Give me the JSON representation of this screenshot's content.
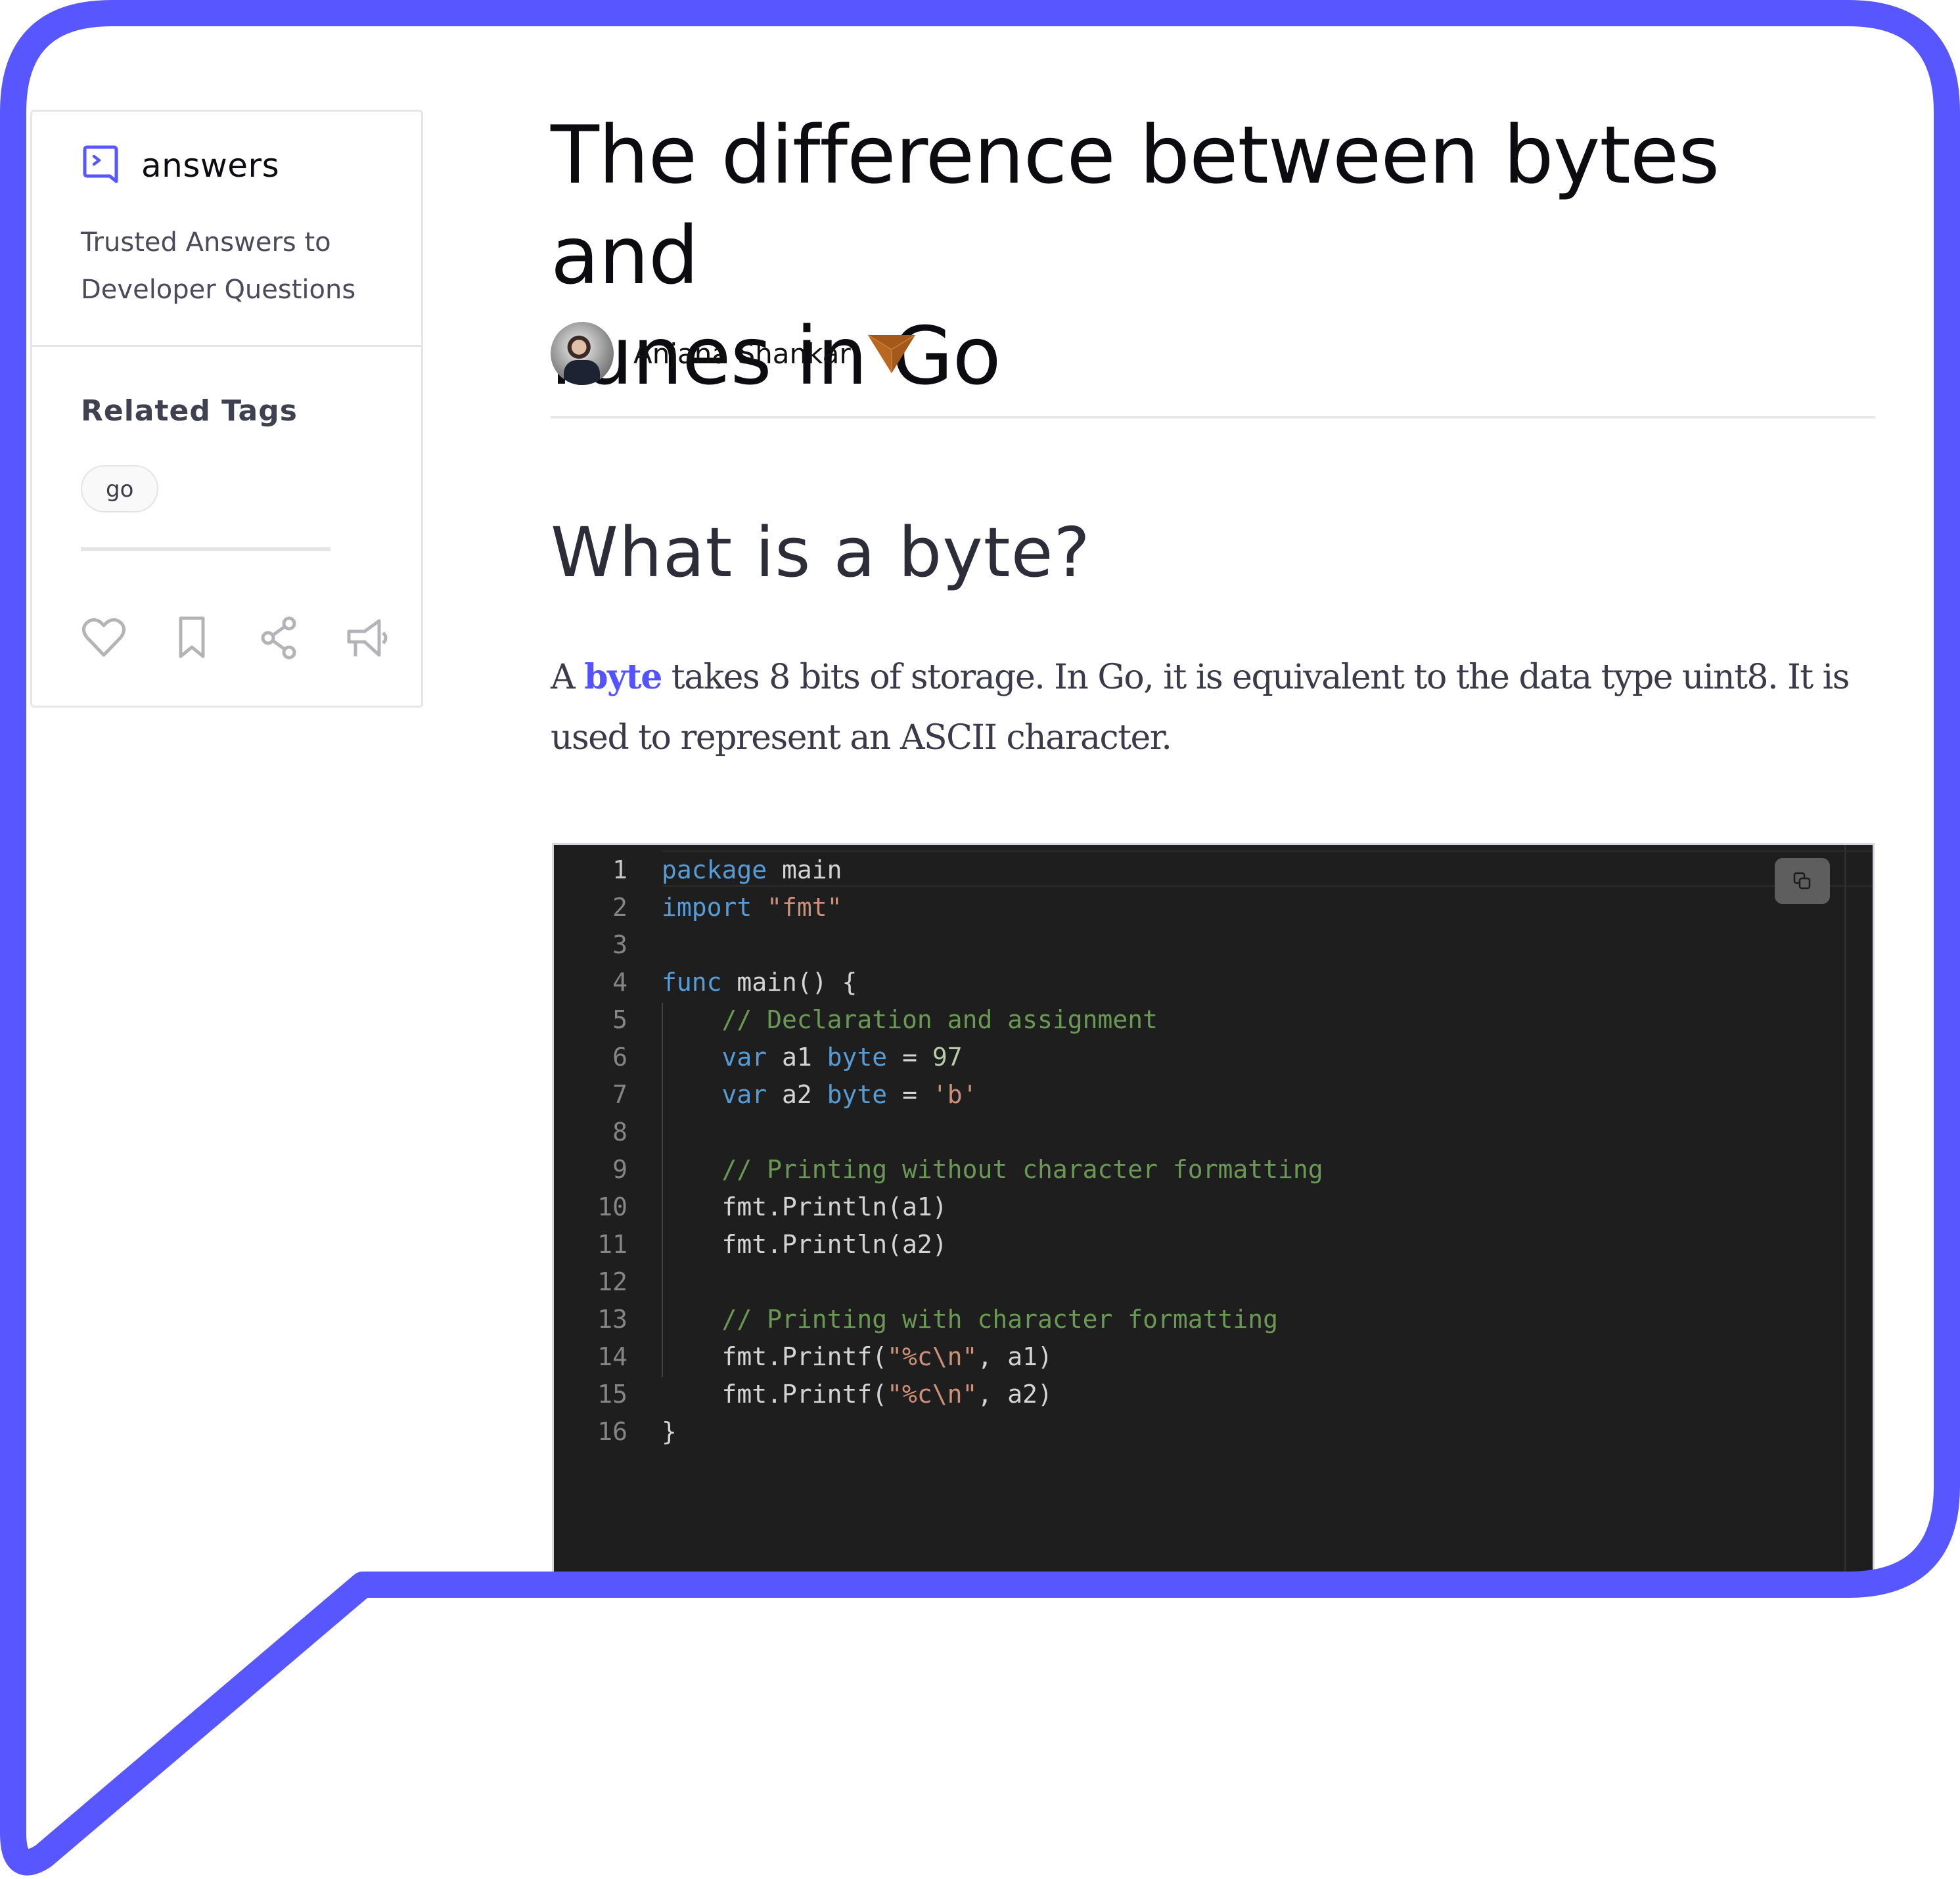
{
  "brand": {
    "name": "answers",
    "tagline_line1": "Trusted Answers to",
    "tagline_line2": "Developer Questions",
    "accent_color": "#5856FF"
  },
  "sidebar": {
    "related_tags_title": "Related Tags",
    "tags": [
      "go"
    ],
    "actions": [
      {
        "name": "like",
        "icon": "heart-icon"
      },
      {
        "name": "bookmark",
        "icon": "bookmark-icon"
      },
      {
        "name": "share",
        "icon": "share-icon"
      },
      {
        "name": "report",
        "icon": "megaphone-icon"
      }
    ]
  },
  "article": {
    "title_line1": "The difference between bytes and",
    "title_line2": "runes in Go",
    "author": "Anjana Shankar",
    "author_badge": "bronze-badge-icon",
    "section_heading": "What is a byte?",
    "paragraph": {
      "lead": "A ",
      "highlight": "byte",
      "rest": " takes 8 bits of storage. In Go, it is equivalent to the data type uint8. It is used to represent an ASCII character."
    }
  },
  "code": {
    "language": "go",
    "copy_label": "copy",
    "lines": [
      {
        "n": "1",
        "tokens": [
          {
            "t": "package",
            "c": "kw"
          },
          {
            "t": " main",
            "c": "id"
          }
        ]
      },
      {
        "n": "2",
        "tokens": [
          {
            "t": "import",
            "c": "kw"
          },
          {
            "t": " ",
            "c": "id"
          },
          {
            "t": "\"fmt\"",
            "c": "str"
          }
        ]
      },
      {
        "n": "3",
        "tokens": []
      },
      {
        "n": "4",
        "tokens": [
          {
            "t": "func",
            "c": "kw"
          },
          {
            "t": " main() {",
            "c": "id"
          }
        ]
      },
      {
        "n": "5",
        "tokens": [
          {
            "t": "    ",
            "c": "id"
          },
          {
            "t": "// Declaration and assignment",
            "c": "cm"
          }
        ]
      },
      {
        "n": "6",
        "tokens": [
          {
            "t": "    ",
            "c": "id"
          },
          {
            "t": "var",
            "c": "kw"
          },
          {
            "t": " a1 ",
            "c": "id"
          },
          {
            "t": "byte",
            "c": "kw"
          },
          {
            "t": " = ",
            "c": "id"
          },
          {
            "t": "97",
            "c": "num"
          }
        ]
      },
      {
        "n": "7",
        "tokens": [
          {
            "t": "    ",
            "c": "id"
          },
          {
            "t": "var",
            "c": "kw"
          },
          {
            "t": " a2 ",
            "c": "id"
          },
          {
            "t": "byte",
            "c": "kw"
          },
          {
            "t": " = ",
            "c": "id"
          },
          {
            "t": "'b'",
            "c": "str"
          }
        ]
      },
      {
        "n": "8",
        "tokens": []
      },
      {
        "n": "9",
        "tokens": [
          {
            "t": "    ",
            "c": "id"
          },
          {
            "t": "// Printing without character formatting",
            "c": "cm"
          }
        ]
      },
      {
        "n": "10",
        "tokens": [
          {
            "t": "    fmt.Println(a1)",
            "c": "id"
          }
        ]
      },
      {
        "n": "11",
        "tokens": [
          {
            "t": "    fmt.Println(a2)",
            "c": "id"
          }
        ]
      },
      {
        "n": "12",
        "tokens": []
      },
      {
        "n": "13",
        "tokens": [
          {
            "t": "    ",
            "c": "id"
          },
          {
            "t": "// Printing with character formatting",
            "c": "cm"
          }
        ]
      },
      {
        "n": "14",
        "tokens": [
          {
            "t": "    fmt.Printf(",
            "c": "id"
          },
          {
            "t": "\"%c\\n\"",
            "c": "str"
          },
          {
            "t": ", a1)",
            "c": "id"
          }
        ]
      },
      {
        "n": "15",
        "tokens": [
          {
            "t": "    fmt.Printf(",
            "c": "id"
          },
          {
            "t": "\"%c\\n\"",
            "c": "str"
          },
          {
            "t": ", a2)",
            "c": "id"
          }
        ]
      },
      {
        "n": "16",
        "tokens": [
          {
            "t": "}",
            "c": "id"
          }
        ]
      }
    ]
  }
}
